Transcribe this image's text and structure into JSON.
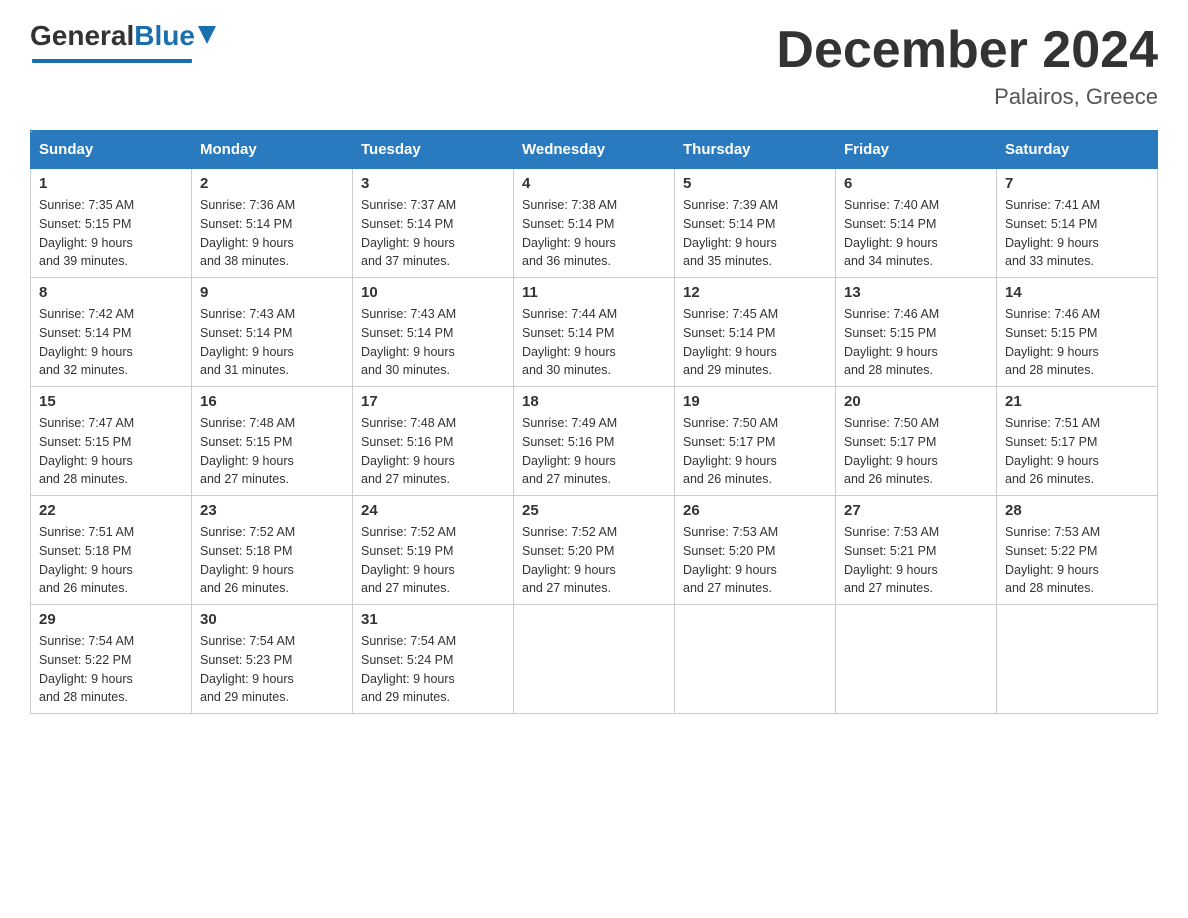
{
  "logo": {
    "general": "General",
    "blue": "Blue"
  },
  "title": {
    "month": "December 2024",
    "location": "Palairos, Greece"
  },
  "header": {
    "days": [
      "Sunday",
      "Monday",
      "Tuesday",
      "Wednesday",
      "Thursday",
      "Friday",
      "Saturday"
    ]
  },
  "weeks": [
    [
      {
        "day": "1",
        "sunrise": "7:35 AM",
        "sunset": "5:15 PM",
        "daylight": "9 hours and 39 minutes."
      },
      {
        "day": "2",
        "sunrise": "7:36 AM",
        "sunset": "5:14 PM",
        "daylight": "9 hours and 38 minutes."
      },
      {
        "day": "3",
        "sunrise": "7:37 AM",
        "sunset": "5:14 PM",
        "daylight": "9 hours and 37 minutes."
      },
      {
        "day": "4",
        "sunrise": "7:38 AM",
        "sunset": "5:14 PM",
        "daylight": "9 hours and 36 minutes."
      },
      {
        "day": "5",
        "sunrise": "7:39 AM",
        "sunset": "5:14 PM",
        "daylight": "9 hours and 35 minutes."
      },
      {
        "day": "6",
        "sunrise": "7:40 AM",
        "sunset": "5:14 PM",
        "daylight": "9 hours and 34 minutes."
      },
      {
        "day": "7",
        "sunrise": "7:41 AM",
        "sunset": "5:14 PM",
        "daylight": "9 hours and 33 minutes."
      }
    ],
    [
      {
        "day": "8",
        "sunrise": "7:42 AM",
        "sunset": "5:14 PM",
        "daylight": "9 hours and 32 minutes."
      },
      {
        "day": "9",
        "sunrise": "7:43 AM",
        "sunset": "5:14 PM",
        "daylight": "9 hours and 31 minutes."
      },
      {
        "day": "10",
        "sunrise": "7:43 AM",
        "sunset": "5:14 PM",
        "daylight": "9 hours and 30 minutes."
      },
      {
        "day": "11",
        "sunrise": "7:44 AM",
        "sunset": "5:14 PM",
        "daylight": "9 hours and 30 minutes."
      },
      {
        "day": "12",
        "sunrise": "7:45 AM",
        "sunset": "5:14 PM",
        "daylight": "9 hours and 29 minutes."
      },
      {
        "day": "13",
        "sunrise": "7:46 AM",
        "sunset": "5:15 PM",
        "daylight": "9 hours and 28 minutes."
      },
      {
        "day": "14",
        "sunrise": "7:46 AM",
        "sunset": "5:15 PM",
        "daylight": "9 hours and 28 minutes."
      }
    ],
    [
      {
        "day": "15",
        "sunrise": "7:47 AM",
        "sunset": "5:15 PM",
        "daylight": "9 hours and 28 minutes."
      },
      {
        "day": "16",
        "sunrise": "7:48 AM",
        "sunset": "5:15 PM",
        "daylight": "9 hours and 27 minutes."
      },
      {
        "day": "17",
        "sunrise": "7:48 AM",
        "sunset": "5:16 PM",
        "daylight": "9 hours and 27 minutes."
      },
      {
        "day": "18",
        "sunrise": "7:49 AM",
        "sunset": "5:16 PM",
        "daylight": "9 hours and 27 minutes."
      },
      {
        "day": "19",
        "sunrise": "7:50 AM",
        "sunset": "5:17 PM",
        "daylight": "9 hours and 26 minutes."
      },
      {
        "day": "20",
        "sunrise": "7:50 AM",
        "sunset": "5:17 PM",
        "daylight": "9 hours and 26 minutes."
      },
      {
        "day": "21",
        "sunrise": "7:51 AM",
        "sunset": "5:17 PM",
        "daylight": "9 hours and 26 minutes."
      }
    ],
    [
      {
        "day": "22",
        "sunrise": "7:51 AM",
        "sunset": "5:18 PM",
        "daylight": "9 hours and 26 minutes."
      },
      {
        "day": "23",
        "sunrise": "7:52 AM",
        "sunset": "5:18 PM",
        "daylight": "9 hours and 26 minutes."
      },
      {
        "day": "24",
        "sunrise": "7:52 AM",
        "sunset": "5:19 PM",
        "daylight": "9 hours and 27 minutes."
      },
      {
        "day": "25",
        "sunrise": "7:52 AM",
        "sunset": "5:20 PM",
        "daylight": "9 hours and 27 minutes."
      },
      {
        "day": "26",
        "sunrise": "7:53 AM",
        "sunset": "5:20 PM",
        "daylight": "9 hours and 27 minutes."
      },
      {
        "day": "27",
        "sunrise": "7:53 AM",
        "sunset": "5:21 PM",
        "daylight": "9 hours and 27 minutes."
      },
      {
        "day": "28",
        "sunrise": "7:53 AM",
        "sunset": "5:22 PM",
        "daylight": "9 hours and 28 minutes."
      }
    ],
    [
      {
        "day": "29",
        "sunrise": "7:54 AM",
        "sunset": "5:22 PM",
        "daylight": "9 hours and 28 minutes."
      },
      {
        "day": "30",
        "sunrise": "7:54 AM",
        "sunset": "5:23 PM",
        "daylight": "9 hours and 29 minutes."
      },
      {
        "day": "31",
        "sunrise": "7:54 AM",
        "sunset": "5:24 PM",
        "daylight": "9 hours and 29 minutes."
      },
      null,
      null,
      null,
      null
    ]
  ],
  "labels": {
    "sunrise": "Sunrise:",
    "sunset": "Sunset:",
    "daylight": "Daylight:"
  }
}
